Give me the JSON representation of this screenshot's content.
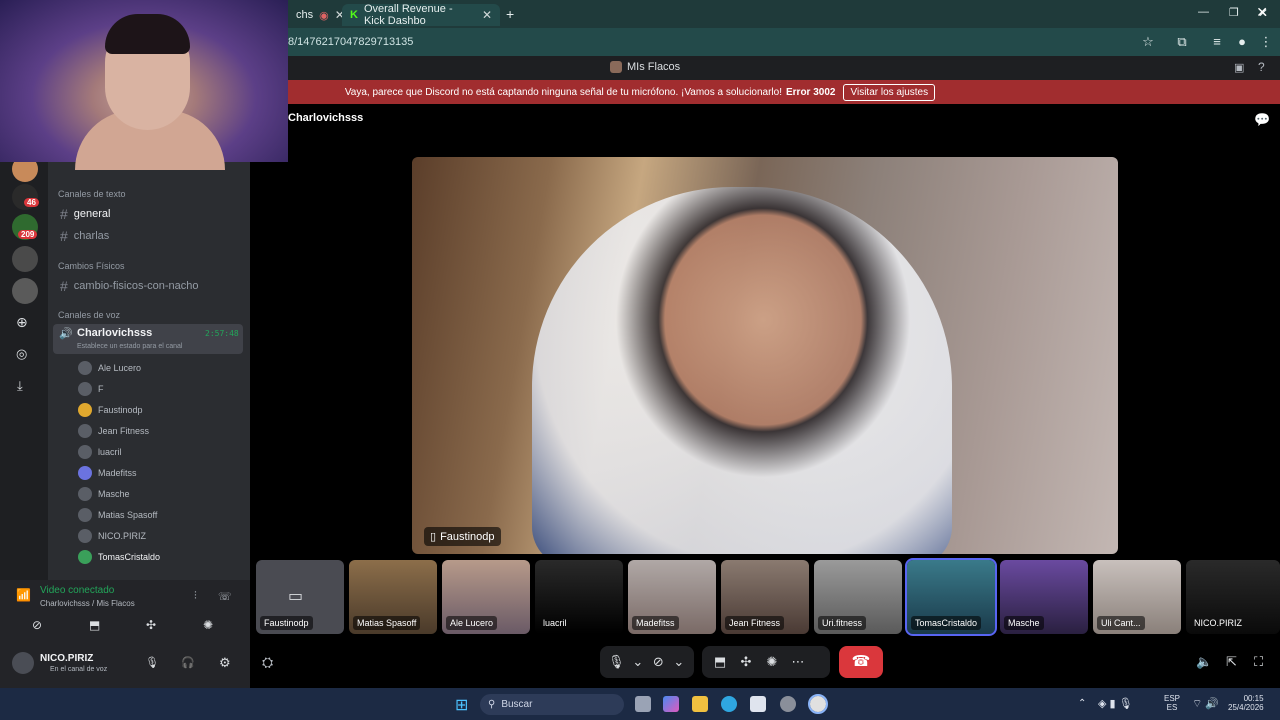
{
  "browser": {
    "tabs": [
      {
        "label": "chs",
        "active": false
      },
      {
        "label": "Overall Revenue - Kick Dashbo",
        "active": true
      }
    ],
    "new_tab": "+",
    "url": "8/1476217047829713135"
  },
  "discord": {
    "window_title": "MIs Flacos",
    "banner": {
      "message": "Vaya, parece que Discord no está captando ninguna señal de tu micrófono. ¡Vamos a solucionarlo!",
      "error": "Error 3002",
      "button": "Visitar los ajustes"
    },
    "call_header": "Charlovichsss",
    "main_video_label": "Faustinodp",
    "thumbnails": [
      {
        "name": "Faustinodp",
        "selected": false
      },
      {
        "name": "Matias Spasoff",
        "selected": false
      },
      {
        "name": "Ale Lucero",
        "selected": false
      },
      {
        "name": "luacril",
        "selected": false
      },
      {
        "name": "Madefitss",
        "selected": false
      },
      {
        "name": "Jean Fitness",
        "selected": false
      },
      {
        "name": "Uri.fitness",
        "selected": false
      },
      {
        "name": "TomasCristaldo",
        "selected": true
      },
      {
        "name": "Masche",
        "selected": false
      },
      {
        "name": "Uli Cant...",
        "selected": false
      },
      {
        "name": "NICO.PIRIZ",
        "selected": false
      }
    ],
    "server_badges": [
      "46",
      "209"
    ],
    "sidebar": {
      "text_category": "Canales de texto",
      "text_channels": [
        "general",
        "charlas"
      ],
      "phys_category": "Cambios Físicos",
      "phys_channels": [
        "cambio-fisicos-con-nacho"
      ],
      "voice_category": "Canales de voz",
      "voice_channel": "Charlovichsss",
      "voice_timer": "2:57:48",
      "voice_status": "Establece un estado para el canal",
      "voice_users": [
        "Ale Lucero",
        "F",
        "Faustinodp",
        "Jean Fitness",
        "luacril",
        "Madefitss",
        "Masche",
        "Matias Spasoff",
        "NICO.PIRIZ",
        "TomasCristaldo"
      ]
    },
    "voice_panel": {
      "status": "Video conectado",
      "channel": "Charlovichsss / Mis Flacos",
      "username": "NICO.PIRIZ",
      "user_status": "En el canal de voz"
    }
  },
  "taskbar": {
    "search": "Buscar",
    "lang": "ESP",
    "lang_sub": "ES",
    "time": "00:15",
    "date": "25/4/2026"
  },
  "colors": {
    "accent": "#5865f2",
    "banner": "#a12d2f",
    "hangup": "#da373c",
    "connected": "#23a55a"
  }
}
